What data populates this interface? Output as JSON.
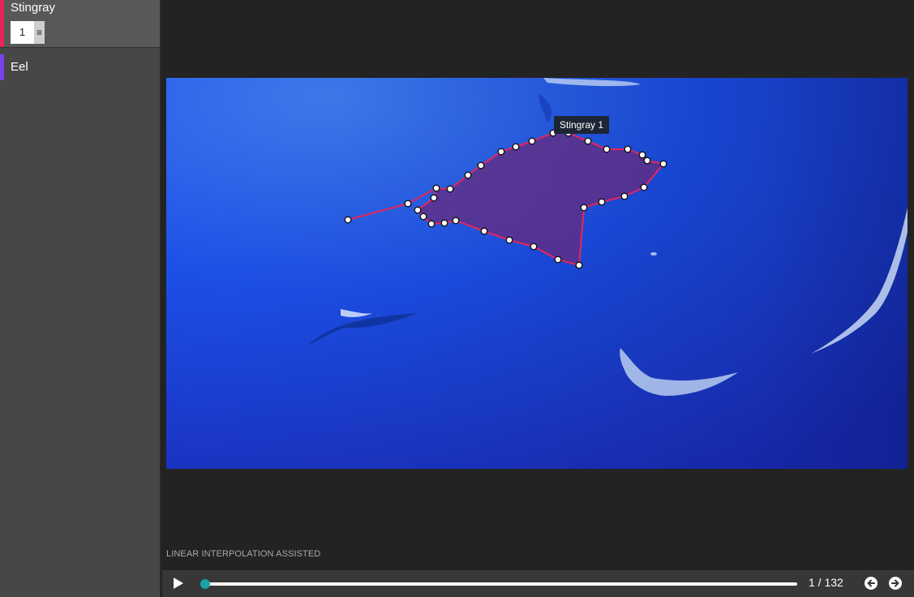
{
  "sidebar": {
    "classes": [
      {
        "name": "Stingray",
        "color": "#e8245a",
        "instances": [
          {
            "id": "1"
          }
        ]
      },
      {
        "name": "Eel",
        "color": "#7b3ff2"
      }
    ]
  },
  "canvas": {
    "annotation": {
      "label": "Stingray 1",
      "outline_color": "#e8245a",
      "fill_color": "#6a2a7a"
    }
  },
  "status": {
    "mode_label": "LINEAR INTERPOLATION ASSISTED"
  },
  "player": {
    "frame_counter": "1 / 132",
    "current_frame": 1,
    "total_frames": 132,
    "accent_color": "#1aa3a3"
  }
}
